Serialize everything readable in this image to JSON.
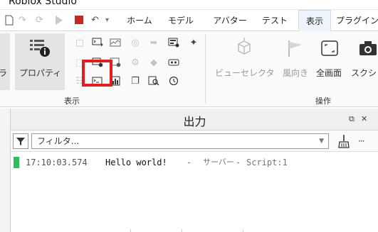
{
  "app": {
    "title": "Roblox Studio"
  },
  "quick_access": {
    "undo_label": "↶",
    "dropdown_label": "▾"
  },
  "menu_tabs": [
    {
      "label": "ホーム"
    },
    {
      "label": "モデル"
    },
    {
      "label": "アバター"
    },
    {
      "label": "テスト"
    },
    {
      "label": "表示",
      "active": true
    },
    {
      "label": "プラグイン"
    }
  ],
  "ribbon": {
    "partial_button_label": "ラ",
    "properties_label": "プロパティ",
    "view_group_label": "表示",
    "view_selector_label": "ビューセレクタ",
    "wind_label": "風向き",
    "fullscreen_label": "全画面",
    "screenshot_label": "スクシ",
    "operations_group_label": "操作"
  },
  "output": {
    "title": "出力",
    "undock_icon": "⧉",
    "close_icon": "✕",
    "filter_placeholder": "フィルタ...",
    "more_icon": "···",
    "log": [
      {
        "time": "17:10:03.574",
        "message": "Hello world!",
        "sep1": "-",
        "source": "サーバー",
        "sep2": "-",
        "script": "Script:1",
        "level_color": "#2bbf5f"
      }
    ]
  },
  "colors": {
    "highlight": "#e11d1d",
    "stop_red": "#c62828",
    "active_tab_bg": "#eef4fb"
  }
}
